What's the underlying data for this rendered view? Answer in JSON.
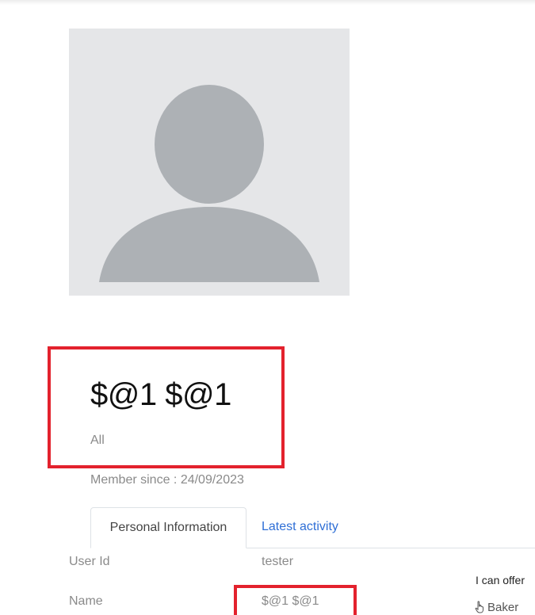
{
  "profile": {
    "avatar_icon": "user-silhouette-icon",
    "name": "$@1 $@1",
    "role": "All",
    "member_since": "Member since : 24/09/2023"
  },
  "tabs": [
    {
      "label": "Personal Information",
      "active": true
    },
    {
      "label": "Latest activity",
      "active": false
    }
  ],
  "personal_info": {
    "user_id_label": "User Id",
    "user_id_value": "tester",
    "name_label": "Name",
    "name_value": "$@1 $@1"
  },
  "side_panel": {
    "offer_text": "I can offer",
    "offer_item": "Baker",
    "offer_icon": "pointing-hand-icon"
  },
  "colors": {
    "highlight": "#e3222d",
    "link": "#2f6fd6",
    "muted_text": "#8a8a8a",
    "avatar_bg": "#e5e6e8",
    "avatar_fg": "#adb1b5"
  }
}
